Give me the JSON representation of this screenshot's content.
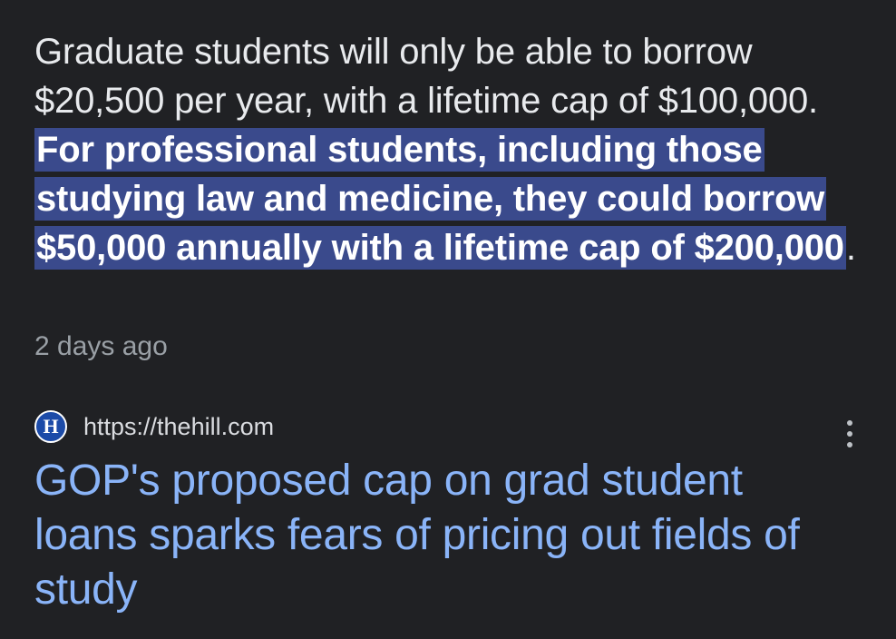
{
  "snippet": {
    "plain": "Graduate students will only be able to borrow $20,500 per year, with a lifetime cap of $100,000. ",
    "highlighted": "For professional students, including those studying law and medicine, they could borrow $50,000 annually with a lifetime cap of $200,000",
    "tail": "."
  },
  "meta": {
    "age": "2 days ago"
  },
  "result": {
    "favicon_letter": "H",
    "favicon_color": "#1c4ba8",
    "url": "https://thehill.com",
    "title": "GOP's proposed cap on grad student loans sparks fears of pricing out fields of study",
    "title_color": "#8ab4f8",
    "more_icon": "vertical-dots-icon"
  },
  "colors": {
    "background": "#202124",
    "highlight": "#3a4a8c"
  }
}
